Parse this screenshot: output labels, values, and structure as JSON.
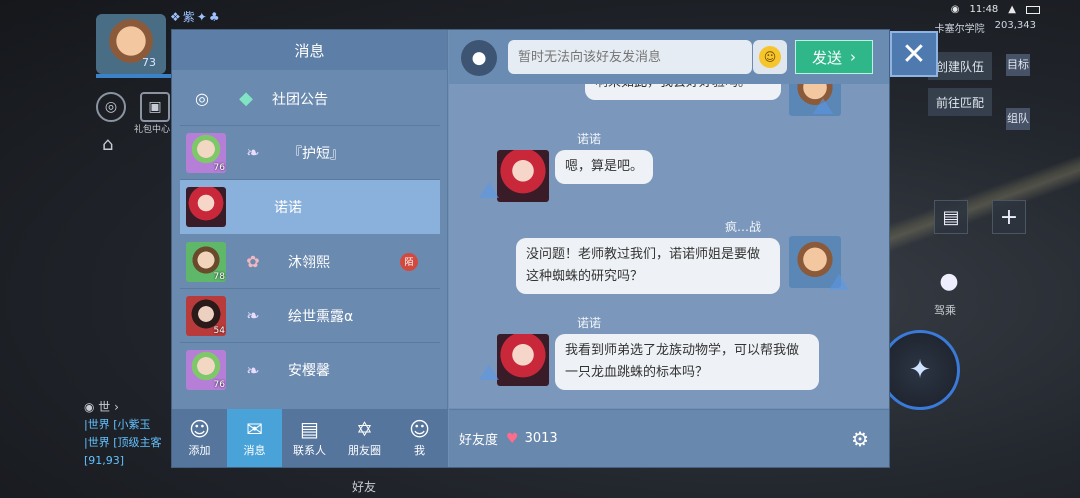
{
  "game": {
    "player_level": "73",
    "top_icons": "❖紫✦♣",
    "status": {
      "time": "11:48"
    },
    "location": {
      "place": "卡塞尔学院",
      "coords": "203,343"
    },
    "gift_label": "礼包中心",
    "chat_lines": [
      "|世界 [小紫玉",
      "|世界 [顶级主客",
      "[91,93]"
    ],
    "chat_mic": "世",
    "side_buttons": [
      "创建队伍",
      "前往匹配"
    ],
    "side_tabs": [
      "目标",
      "组队"
    ],
    "ride_label": "驾乘",
    "friends_label": "好友"
  },
  "sidebar": {
    "title": "消息",
    "contacts": [
      {
        "name": "社团公告",
        "type": "notice"
      },
      {
        "name": "『护短』",
        "level": "76"
      },
      {
        "name": "诺诺",
        "active": true
      },
      {
        "name": "沐翎熙",
        "level": "78",
        "badge": "陌"
      },
      {
        "name": "绘世熏露α",
        "level": "54"
      },
      {
        "name": "安樱馨",
        "level": "76"
      }
    ],
    "nav": [
      {
        "label": "添加",
        "icon": "add-friend-icon"
      },
      {
        "label": "消息",
        "icon": "message-icon",
        "active": true
      },
      {
        "label": "联系人",
        "icon": "contacts-icon"
      },
      {
        "label": "朋友圈",
        "icon": "moments-icon"
      },
      {
        "label": "我",
        "icon": "profile-icon"
      }
    ]
  },
  "chat": {
    "input_placeholder": "暂时无法向该好友发消息",
    "send_label": "发送",
    "messages": [
      {
        "sender": "",
        "text": "啊来如此，我会好好验吗。",
        "side": "right",
        "partial": true
      },
      {
        "sender": "诺诺",
        "text": "嗯，算是吧。",
        "side": "left"
      },
      {
        "sender": "疯…战",
        "text": "没问题！老师教过我们，诺诺师姐是要做这种蜘蛛的研究吗？",
        "side": "right"
      },
      {
        "sender": "诺诺",
        "text": "我看到师弟选了龙族动物学，可以帮我做一只龙血跳蛛的标本吗？",
        "side": "left"
      }
    ],
    "favor_label": "好友度",
    "favor_value": "3013"
  },
  "colors": {
    "dialog_bg": "#6f8fb4",
    "active_contact": "#8ab0dc",
    "send_button": "#2fb78a",
    "active_nav": "#4aa3d8",
    "badge": "#d24a3f"
  }
}
